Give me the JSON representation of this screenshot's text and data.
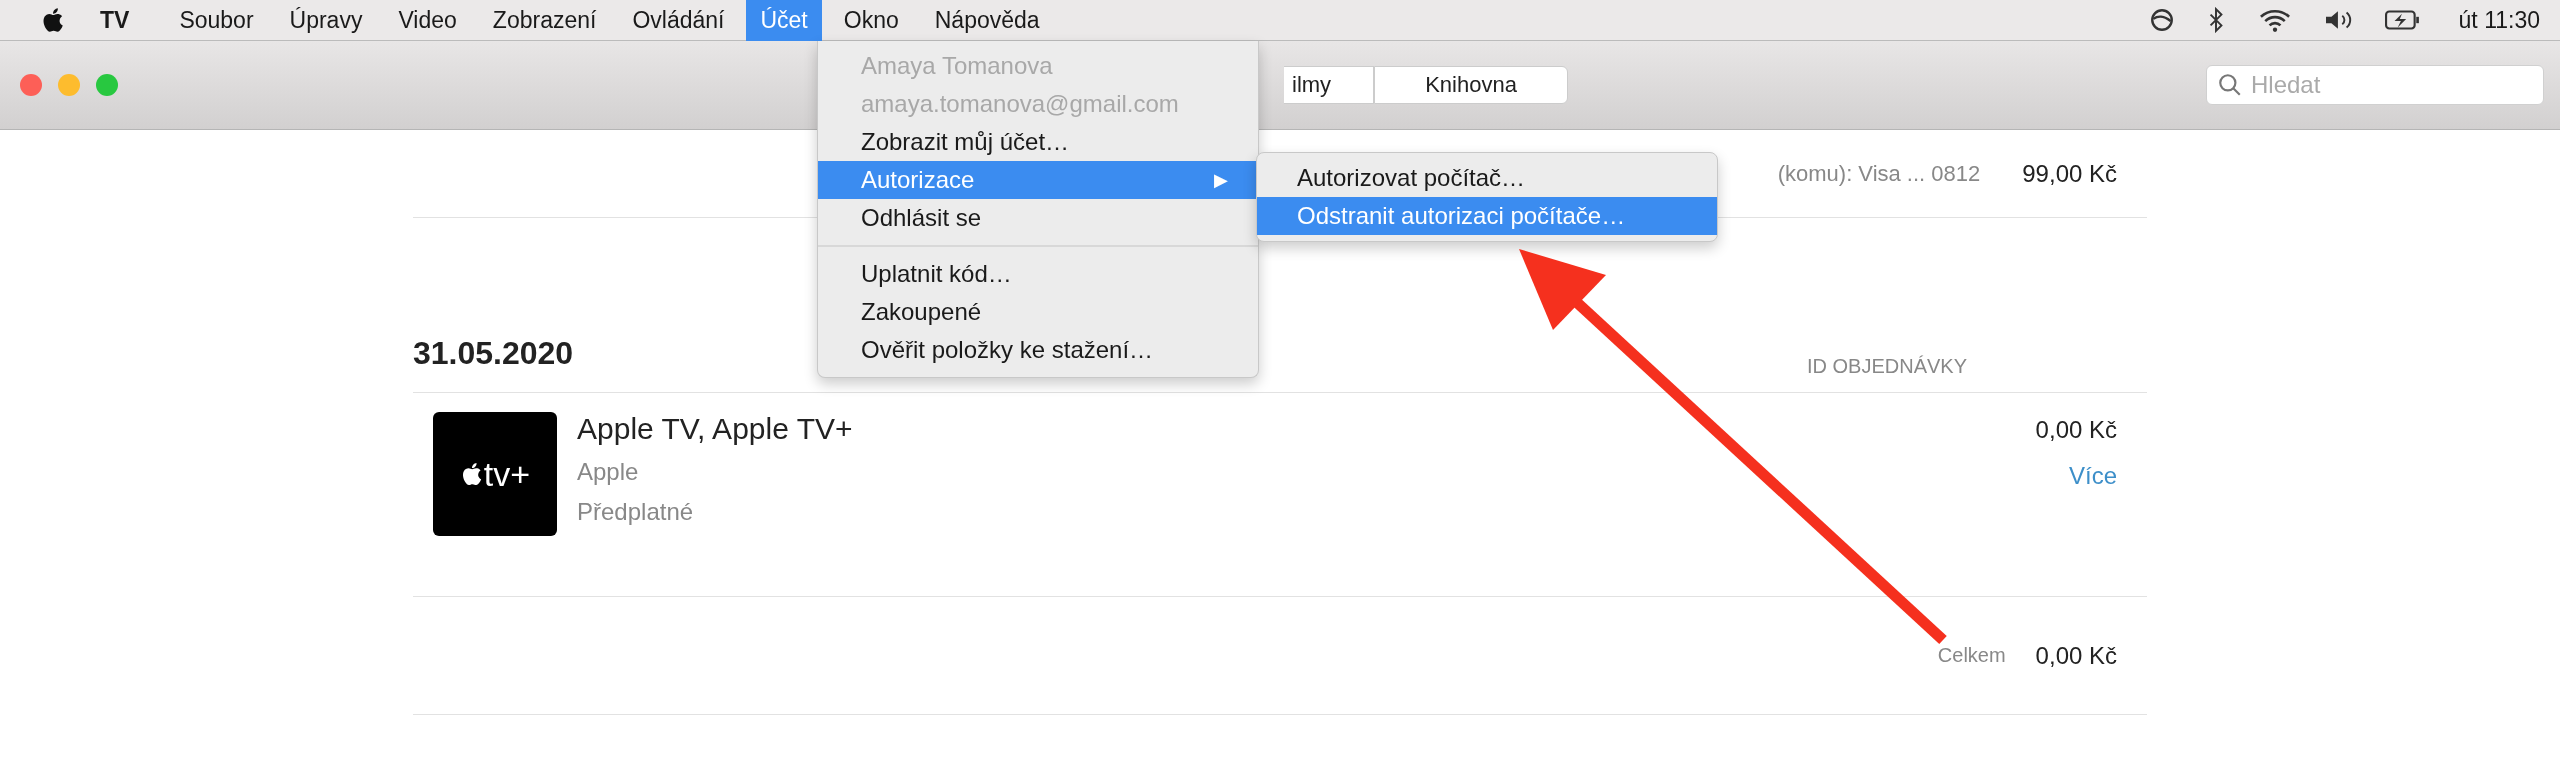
{
  "menubar": {
    "app": "TV",
    "menus": [
      {
        "label": "Soubor",
        "selected": false
      },
      {
        "label": "Úpravy",
        "selected": false
      },
      {
        "label": "Video",
        "selected": false
      },
      {
        "label": "Zobrazení",
        "selected": false
      },
      {
        "label": "Ovládání",
        "selected": false
      },
      {
        "label": "Účet",
        "selected": true
      },
      {
        "label": "Okno",
        "selected": false
      },
      {
        "label": "Nápověda",
        "selected": false
      }
    ],
    "clock": "út 11:30"
  },
  "toolbar": {
    "segments": [
      {
        "label": "ilmy"
      },
      {
        "label": "Knihovna"
      }
    ],
    "search": {
      "placeholder": "Hledat"
    }
  },
  "account_menu": {
    "items": [
      {
        "kind": "item",
        "label": "Amaya Tomanova",
        "disabled": true,
        "selected": false
      },
      {
        "kind": "item",
        "label": "amaya.tomanova@gmail.com",
        "disabled": true,
        "selected": false
      },
      {
        "kind": "item",
        "label": "Zobrazit můj účet…",
        "disabled": false,
        "selected": false
      },
      {
        "kind": "submenu",
        "label": "Autorizace",
        "arrow": "▶",
        "disabled": false,
        "selected": true
      },
      {
        "kind": "item",
        "label": "Odhlásit se",
        "disabled": false,
        "selected": false
      },
      {
        "kind": "separator"
      },
      {
        "kind": "item",
        "label": "Uplatnit kód…",
        "disabled": false,
        "selected": false
      },
      {
        "kind": "item",
        "label": "Zakoupené",
        "disabled": false,
        "selected": false
      },
      {
        "kind": "item",
        "label": "Ověřit položky ke stažení…",
        "disabled": false,
        "selected": false
      }
    ]
  },
  "submenu": {
    "items": [
      {
        "label": "Autorizovat počítač…",
        "selected": false
      },
      {
        "label": "Odstranit autorizaci počítače…",
        "selected": true
      }
    ]
  },
  "payment_row": {
    "method": "(komu): Visa ... 0812",
    "amount": "99,00 Kč"
  },
  "order": {
    "date": "31.05.2020",
    "id_label": "ID OBJEDNÁVKY",
    "item": {
      "logo_text": "tv+",
      "title": "Apple TV, Apple TV+",
      "publisher": "Apple",
      "type": "Předplatné",
      "price": "0,00 Kč",
      "more": "Více"
    },
    "total_label": "Celkem",
    "total": "0,00 Kč"
  }
}
